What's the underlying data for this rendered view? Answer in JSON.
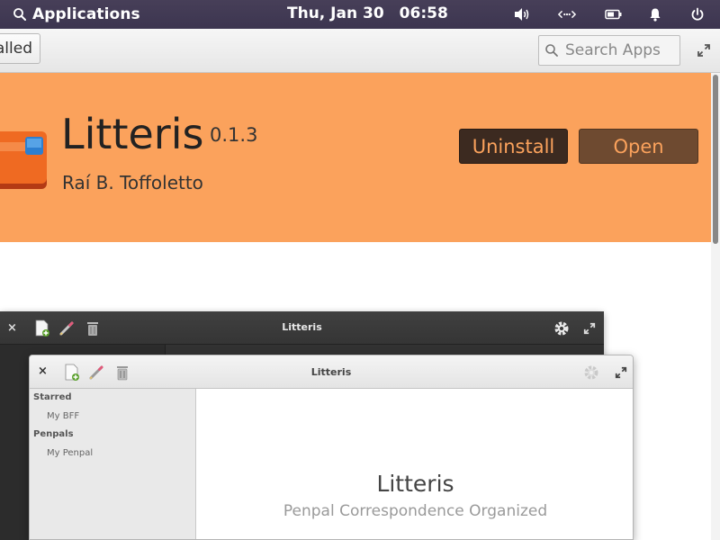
{
  "panel": {
    "applications_label": "Applications",
    "date": "Thu, Jan 30",
    "time": "06:58",
    "indicators": [
      "volume-icon",
      "network-icon",
      "battery-icon",
      "notifications-icon",
      "power-icon"
    ]
  },
  "header": {
    "installed_label": "alled",
    "search_placeholder": "Search Apps",
    "maximize_icon": "maximize-icon"
  },
  "banner": {
    "color": "#fba25c",
    "app_name": "Litteris",
    "version": "0.1.3",
    "author": "Raí B. Toffoletto",
    "uninstall_label": "Uninstall",
    "open_label": "Open",
    "icon": "litteris-app-icon"
  },
  "screenshot": {
    "dark_window": {
      "title": "Litteris",
      "close_label": "×"
    },
    "light_window": {
      "title": "Litteris",
      "close_label": "×",
      "sidebar": [
        {
          "heading": "Starred",
          "items": [
            "My BFF"
          ]
        },
        {
          "heading": "Penpals",
          "items": [
            "My Penpal"
          ]
        }
      ],
      "welcome_title": "Litteris",
      "welcome_subtitle": "Penpal Correspondence Organized"
    }
  }
}
